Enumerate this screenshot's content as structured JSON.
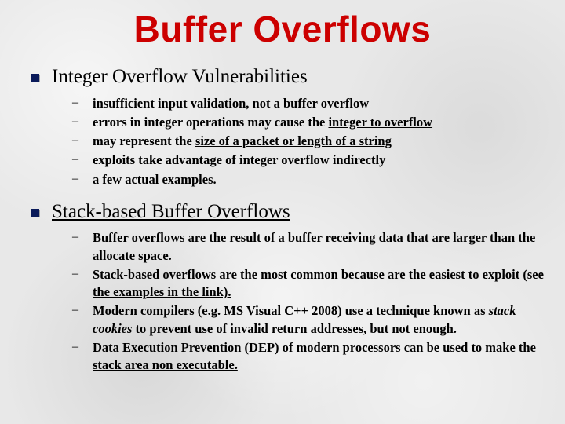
{
  "title": "Buffer Overflows",
  "section1": {
    "heading": "Integer Overflow Vulnerabilities",
    "items": [
      {
        "pre": "insufficient input validation, not a buffer overflow",
        "u": "",
        "post": ""
      },
      {
        "pre": "errors in integer operations may cause the ",
        "u": "integer to overflow",
        "post": ""
      },
      {
        "pre": "may represent the ",
        "u": "size of a packet or length of a string",
        "post": ""
      },
      {
        "pre": "exploits take advantage of integer overflow indirectly",
        "u": "",
        "post": ""
      },
      {
        "pre": "a few ",
        "u": "actual examples.",
        "post": ""
      }
    ]
  },
  "section2": {
    "heading": "Stack-based Buffer Overflows",
    "items": [
      {
        "text": "Buffer overflows are the result of a buffer receiving data that are larger than the allocate space."
      },
      {
        "text": " Stack-based overflows are the most common because are the easiest to exploit (see the examples in the link)."
      },
      {
        "pre": "Modern compilers (e.g. MS Visual C++ 2008) use a technique known as ",
        "u": "stack cookies",
        "post": " to prevent use of  invalid return addresses, but not enough."
      },
      {
        "text": "Data Execution Prevention (DEP) of modern processors can be used to make the stack area non executable."
      }
    ]
  }
}
